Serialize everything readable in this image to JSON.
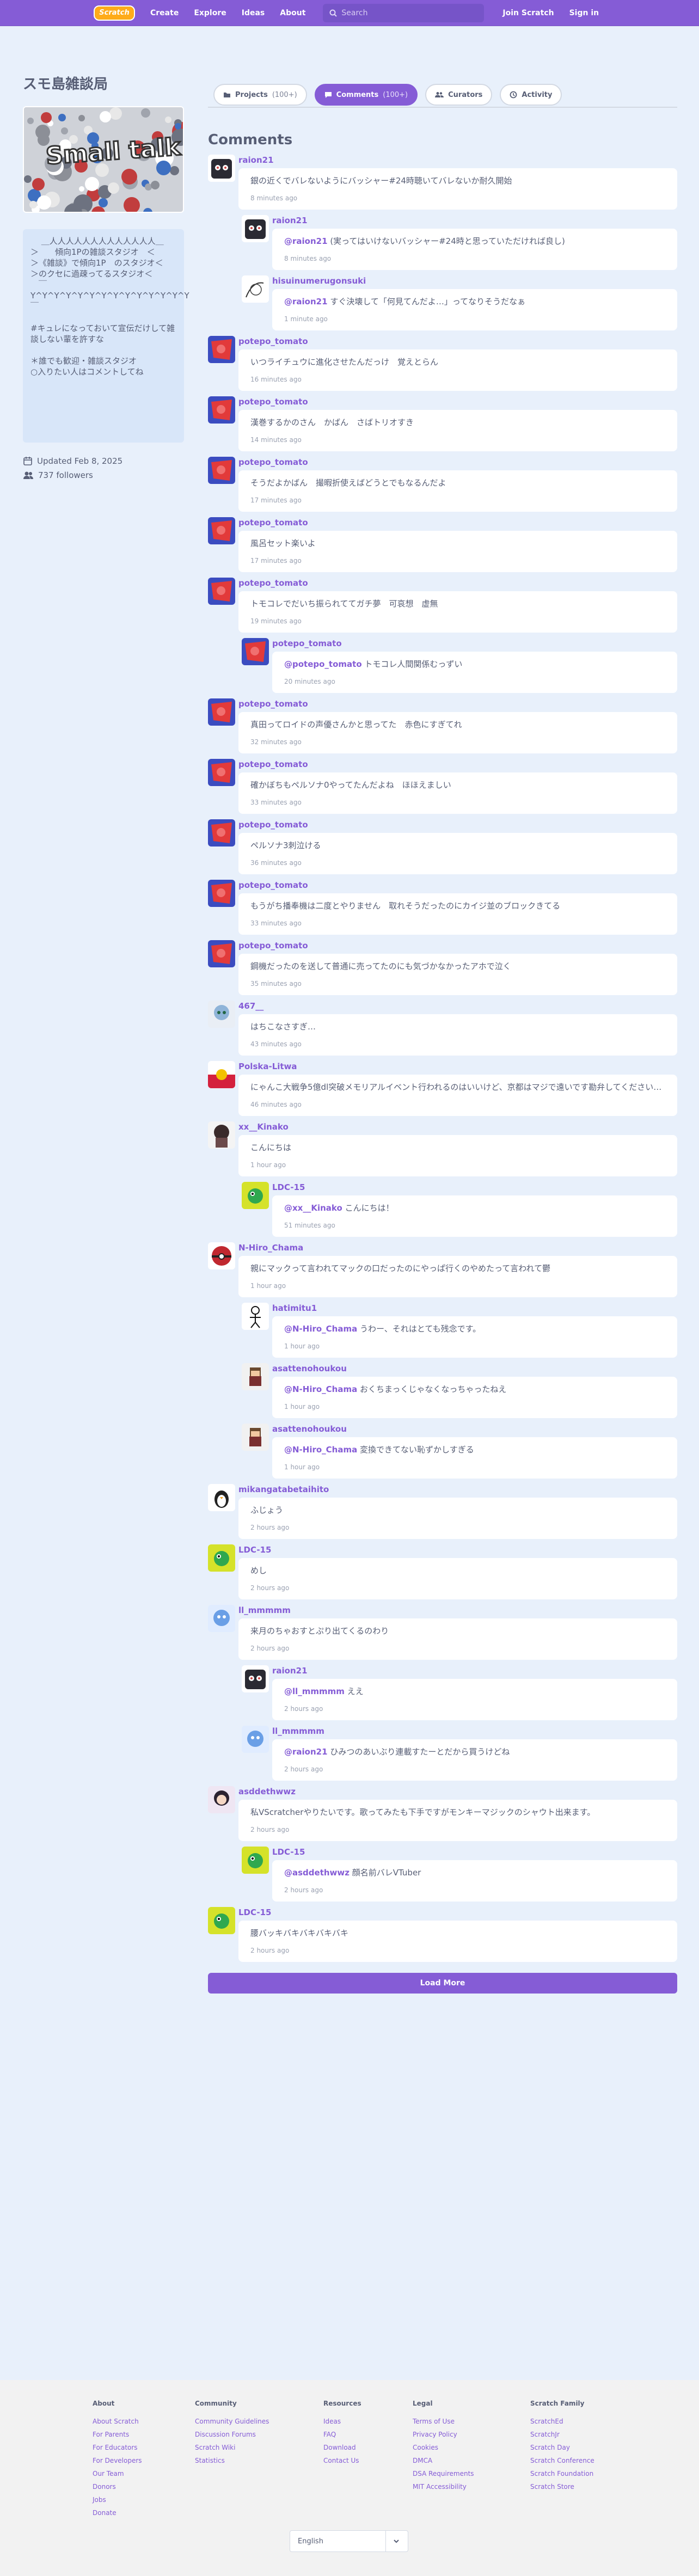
{
  "nav": {
    "logo": "Scratch",
    "links": [
      "Create",
      "Explore",
      "Ideas",
      "About"
    ],
    "search_placeholder": "Search",
    "join": "Join Scratch",
    "signin": "Sign in"
  },
  "studio": {
    "title": "スモ島雑談局",
    "thumb_text": "Small talk",
    "description": "　 ＿人人人人人人人人人人人人人＿\n＞　　傾向1Pの雑談スタジオ　＜\n＞《雑談》で傾向1P　のスタジオ＜\n＞のクセに過疎ってるスタジオ＜\n　￣Y^Y^Y^Y^Y^Y^Y^Y^Y^Y^Y^Y^Y^Y￣\n\n#キュレになっておいて宣伝だけして雑談しない輩を許すな\n\n＊誰でも歓迎・雑談スタジオ\n○入りたい人はコメントしてね",
    "updated": "Updated Feb 8, 2025",
    "followers": "737 followers"
  },
  "tabs": [
    {
      "label": "Projects",
      "count": "(100+)",
      "icon": "folder-icon"
    },
    {
      "label": "Comments",
      "count": "(100+)",
      "icon": "comment-icon"
    },
    {
      "label": "Curators",
      "count": "",
      "icon": "people-icon"
    },
    {
      "label": "Activity",
      "count": "",
      "icon": "activity-icon"
    }
  ],
  "comments_heading": "Comments",
  "comments": [
    {
      "user": "raion21",
      "text": "銀の近くでバレないようにバッシャー#24時聴いてバレないか耐久開始",
      "time": "8 minutes ago",
      "reply": false,
      "avatar": "cartoon"
    },
    {
      "user": "raion21",
      "mention": "@raion21",
      "text": "(実ってはいけないバッシャー#24時と思っていただければ良し)",
      "time": "8 minutes ago",
      "reply": true,
      "avatar": "cartoon"
    },
    {
      "user": "hisuinumerugonsuki",
      "mention": "@raion21",
      "text": "すぐ決壊して「何見てんだよ…」ってなりそうだなぁ",
      "time": "1 minute ago",
      "reply": true,
      "avatar": "sketch"
    },
    {
      "user": "potepo_tomato",
      "text": "いつライチュウに進化させたんだっけ　覚えとらん",
      "time": "16 minutes ago",
      "reply": false,
      "avatar": "red"
    },
    {
      "user": "potepo_tomato",
      "text": "漢巻するかのさん　かばん　さばトリオすき",
      "time": "14 minutes ago",
      "reply": false,
      "avatar": "red"
    },
    {
      "user": "potepo_tomato",
      "text": "そうだよかばん　撮暇折使えばどうとでもなるんだよ",
      "time": "17 minutes ago",
      "reply": false,
      "avatar": "red"
    },
    {
      "user": "potepo_tomato",
      "text": "風呂セット楽いよ",
      "time": "17 minutes ago",
      "reply": false,
      "avatar": "red"
    },
    {
      "user": "potepo_tomato",
      "text": "トモコレでだいち振られててガチ夢　可哀想　虚無",
      "time": "19 minutes ago",
      "reply": false,
      "avatar": "red"
    },
    {
      "user": "potepo_tomato",
      "mention": "@potepo_tomato",
      "text": "トモコレ人間関係むっずい",
      "time": "20 minutes ago",
      "reply": true,
      "avatar": "red"
    },
    {
      "user": "potepo_tomato",
      "text": "真田ってロイドの声優さんかと思ってた　赤色にすぎてれ",
      "time": "32 minutes ago",
      "reply": false,
      "avatar": "red"
    },
    {
      "user": "potepo_tomato",
      "text": "確かぼちもペルソナ0やってたんだよね　ほほえましい",
      "time": "33 minutes ago",
      "reply": false,
      "avatar": "red"
    },
    {
      "user": "potepo_tomato",
      "text": "ペルソナ3刺泣ける",
      "time": "36 minutes ago",
      "reply": false,
      "avatar": "red"
    },
    {
      "user": "potepo_tomato",
      "text": "もうがち播奉機は二度とやりません　取れそうだったのにカイジ並のブロックきてる",
      "time": "33 minutes ago",
      "reply": false,
      "avatar": "red"
    },
    {
      "user": "potepo_tomato",
      "text": "鋼機だったのを送して普通に売ってたのにも気づかなかったアホで泣く",
      "time": "35 minutes ago",
      "reply": false,
      "avatar": "red"
    },
    {
      "user": "467__",
      "text": "はちこなさすぎ…",
      "time": "43 minutes ago",
      "reply": false,
      "avatar": "anime"
    },
    {
      "user": "Polska-Litwa",
      "text": "にゃんこ大戦争5億dl突破メモリアルイベント行われるのはいいけど、京都はマジで遠いです勘弁してください…",
      "time": "46 minutes ago",
      "reply": false,
      "avatar": "flag"
    },
    {
      "user": "xx__Kinako",
      "text": "こんにちは",
      "time": "1 hour ago",
      "reply": false,
      "avatar": "dark"
    },
    {
      "user": "LDC-15",
      "mention": "@xx__Kinako",
      "text": "こんにちは！",
      "time": "51 minutes ago",
      "reply": true,
      "avatar": "green"
    },
    {
      "user": "N-Hiro_Chama",
      "text": "親にマックって言われてマックの口だったのにやっぱ行くのやめたって言われて鬱",
      "time": "1 hour ago",
      "reply": false,
      "avatar": "redball"
    },
    {
      "user": "hatimitu1",
      "mention": "@N-Hiro_Chama",
      "text": "うわー、それはとても残念です。",
      "time": "1 hour ago",
      "reply": true,
      "avatar": "stick"
    },
    {
      "user": "asattenohoukou",
      "mention": "@N-Hiro_Chama",
      "text": "おくちまっくじゃなくなっちゃったねえ",
      "time": "1 hour ago",
      "reply": true,
      "avatar": "pixel"
    },
    {
      "user": "asattenohoukou",
      "mention": "@N-Hiro_Chama",
      "text": "変換できてない恥ずかしすぎる",
      "time": "1 hour ago",
      "reply": true,
      "avatar": "pixel"
    },
    {
      "user": "mikangatabetaihito",
      "text": "ふじょう",
      "time": "2 hours ago",
      "reply": false,
      "avatar": "penguin"
    },
    {
      "user": "LDC-15",
      "text": "めし",
      "time": "2 hours ago",
      "reply": false,
      "avatar": "green"
    },
    {
      "user": "ll_mmmmm",
      "text": "来月のちゃおすとぷり出てくるのわり",
      "time": "2 hours ago",
      "reply": false,
      "avatar": "blue"
    },
    {
      "user": "raion21",
      "mention": "@ll_mmmmm",
      "text": "ええ",
      "time": "2 hours ago",
      "reply": true,
      "avatar": "cartoon"
    },
    {
      "user": "ll_mmmmm",
      "mention": "@raion21",
      "text": "ひみつのあいぶり連載すたーとだから買うけどね",
      "time": "2 hours ago",
      "reply": true,
      "avatar": "blue"
    },
    {
      "user": "asddethwwz",
      "text": "私VScratcherやりたいです。歌ってみたも下手ですがモンキーマジックのシャウト出来ます。",
      "time": "2 hours ago",
      "reply": false,
      "avatar": "girl"
    },
    {
      "user": "LDC-15",
      "mention": "@asddethwwz",
      "text": "顔名前バレVTuber",
      "time": "2 hours ago",
      "reply": true,
      "avatar": "green"
    },
    {
      "user": "LDC-15",
      "text": "腰バッキバキバキバキバキ",
      "time": "2 hours ago",
      "reply": false,
      "avatar": "green"
    }
  ],
  "load_more": "Load More",
  "footer": {
    "columns": [
      {
        "title": "About",
        "links": [
          "About Scratch",
          "For Parents",
          "For Educators",
          "For Developers",
          "Our Team",
          "Donors",
          "Jobs",
          "Donate"
        ]
      },
      {
        "title": "Community",
        "links": [
          "Community Guidelines",
          "Discussion Forums",
          "Scratch Wiki",
          "Statistics"
        ]
      },
      {
        "title": "Resources",
        "links": [
          "Ideas",
          "FAQ",
          "Download",
          "Contact Us"
        ]
      },
      {
        "title": "Legal",
        "links": [
          "Terms of Use",
          "Privacy Policy",
          "Cookies",
          "DMCA",
          "DSA Requirements",
          "MIT Accessibility"
        ]
      },
      {
        "title": "Scratch Family",
        "links": [
          "ScratchEd",
          "ScratchJr",
          "Scratch Day",
          "Scratch Conference",
          "Scratch Foundation",
          "Scratch Store"
        ]
      }
    ],
    "language": "English"
  },
  "colors": {
    "brand": "#855cd6",
    "accent": "#ffab19",
    "bg": "#e8f0fb"
  }
}
